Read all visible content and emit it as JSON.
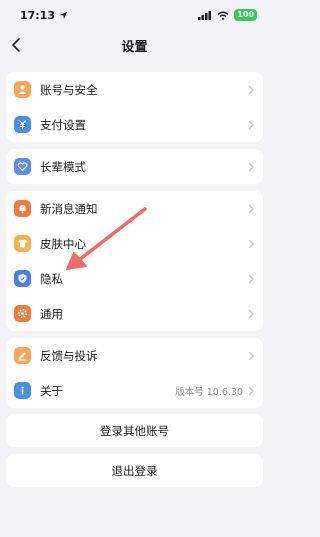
{
  "status": {
    "time": "17:13",
    "battery": "100"
  },
  "nav": {
    "title": "设置"
  },
  "groups": [
    [
      {
        "label": "账号与安全",
        "icon": "person-icon",
        "color": "#f5a75a"
      },
      {
        "label": "支付设置",
        "icon": "yuan-icon",
        "color": "#4a90e2"
      }
    ],
    [
      {
        "label": "长辈模式",
        "icon": "heart-icon",
        "color": "#5b8def"
      }
    ],
    [
      {
        "label": "新消息通知",
        "icon": "bell-icon",
        "color": "#f07b3f"
      },
      {
        "label": "皮肤中心",
        "icon": "shirt-icon",
        "color": "#f2b34a"
      },
      {
        "label": "隐私",
        "icon": "shield-icon",
        "color": "#4a7ee8"
      },
      {
        "label": "通用",
        "icon": "gear-icon",
        "color": "#f07b3f"
      }
    ],
    [
      {
        "label": "反馈与投诉",
        "icon": "pencil-icon",
        "color": "#f5a75a"
      },
      {
        "label": "关于",
        "icon": "info-icon",
        "color": "#4a90e2",
        "value": "版本号 10.6.30"
      }
    ]
  ],
  "buttons": {
    "login_other": "登录其他账号",
    "logout": "退出登录"
  }
}
